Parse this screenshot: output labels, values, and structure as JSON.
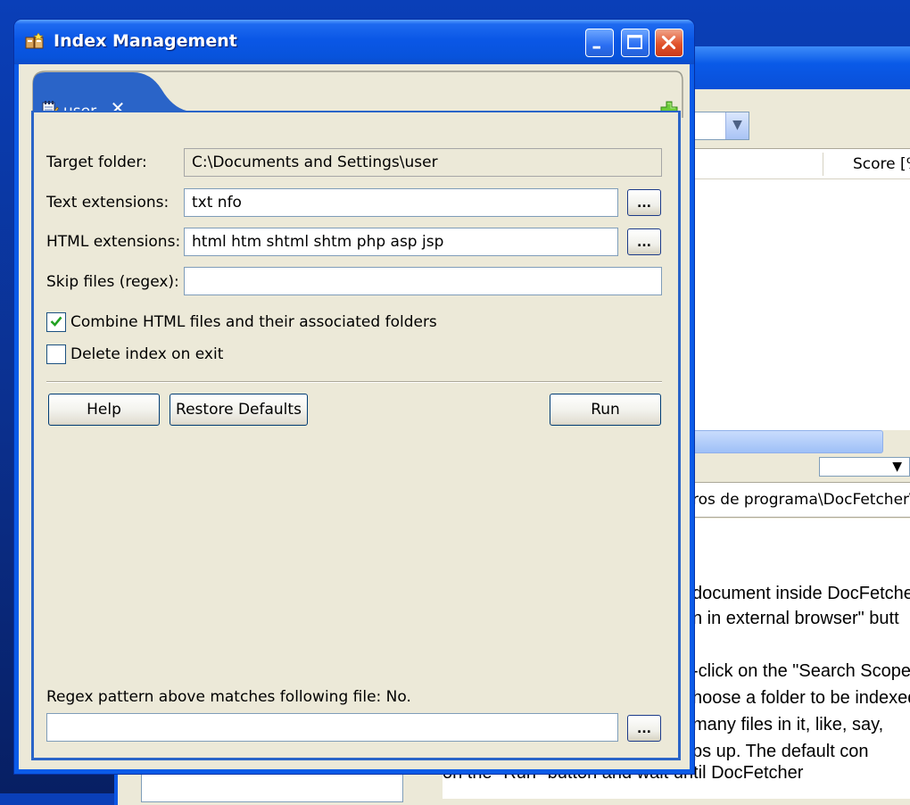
{
  "background_window": {
    "score_header": "Score [%]",
    "path_text": "ros de programa\\DocFetcher\\h",
    "doc_lines": [
      "document inside DocFetcher",
      "n in external browser\" butt",
      "-click on the \"Search Scope\"",
      "hoose a folder to be indexed",
      "many files in it, like, say,",
      "ps up. The default con"
    ],
    "doc_bottom_line": "on the \"Run\" button and wait until DocFetcher"
  },
  "dialog": {
    "title": "Index Management",
    "title_icon": "index-management-icon",
    "window_controls": [
      "minimize",
      "maximize",
      "close"
    ],
    "tab": {
      "label": "user",
      "icon": "notepad-icon",
      "close_icon": "close-icon"
    },
    "add_tab_icon": "plus-icon",
    "form": {
      "target_folder": {
        "label": "Target folder:",
        "value": "C:\\Documents and Settings\\user"
      },
      "text_extensions": {
        "label": "Text extensions:",
        "value": "txt nfo",
        "browse": "..."
      },
      "html_extensions": {
        "label": "HTML extensions:",
        "value": "html htm shtml shtm php asp jsp",
        "browse": "..."
      },
      "skip_files": {
        "label": "Skip files (regex):",
        "value": ""
      },
      "combine_html": {
        "label": "Combine HTML files and their associated folders",
        "checked": true
      },
      "delete_on_exit": {
        "label": "Delete index on exit",
        "checked": false
      }
    },
    "buttons": {
      "help": "Help",
      "restore_defaults": "Restore Defaults",
      "run": "Run"
    },
    "regex_test": {
      "label": "Regex pattern above matches following file: No.",
      "value": "",
      "browse": "..."
    }
  },
  "colors": {
    "titlebar": "#0a57e6",
    "tab_active": "#2a64c8",
    "dialog_bg": "#ece9d8",
    "checkmark": "#21a121"
  }
}
